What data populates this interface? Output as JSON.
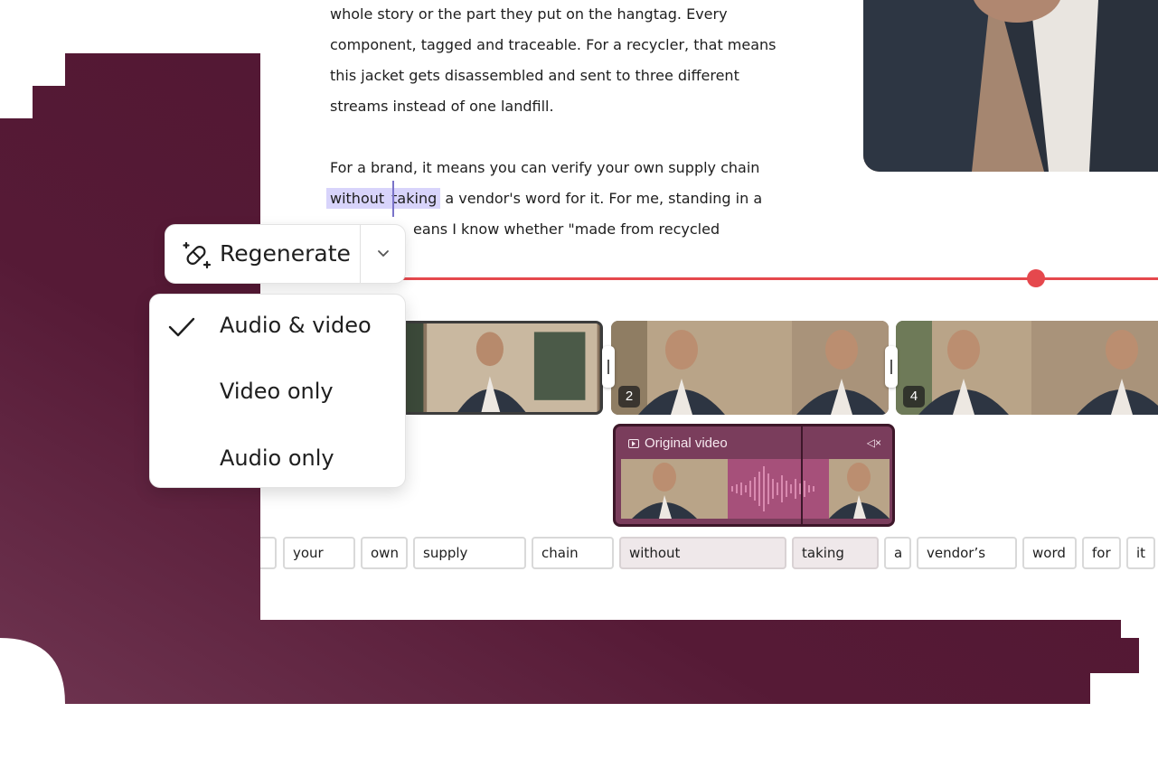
{
  "transcript": {
    "lines": [
      "whole story or the part they put on the hangtag. Every",
      "component, tagged and traceable. For a recycler, that means",
      "this jacket gets disassembled and sent to three different",
      "streams instead of one landfill.",
      "For a brand, it means you can verify your own supply chain"
    ],
    "line6_hl1": "without",
    "line6_hl2": "taking",
    "line6_rest": "a vendor's word for it. For me, standing in a",
    "line7_partial": "eans I know whether \"made from recycled"
  },
  "regenerate": {
    "label": "Regenerate"
  },
  "menu": {
    "items": [
      {
        "label": "Audio & video",
        "checked": true
      },
      {
        "label": "Video only",
        "checked": false
      },
      {
        "label": "Audio only",
        "checked": false
      }
    ]
  },
  "clips": [
    {
      "number": "2"
    },
    {
      "number": "4"
    }
  ],
  "original_video": {
    "label": "Original video",
    "mute_icon": "speaker-muted-icon"
  },
  "words": [
    "your",
    "own",
    "supply",
    "chain",
    "without",
    "taking",
    "a",
    "vendor’s",
    "word",
    "for",
    "it"
  ],
  "colors": {
    "accent_red": "#e5484d",
    "highlight": "#d8d4fb",
    "background_maroon": "#5a1c3a",
    "original_video_bg": "#7a3d5c"
  }
}
